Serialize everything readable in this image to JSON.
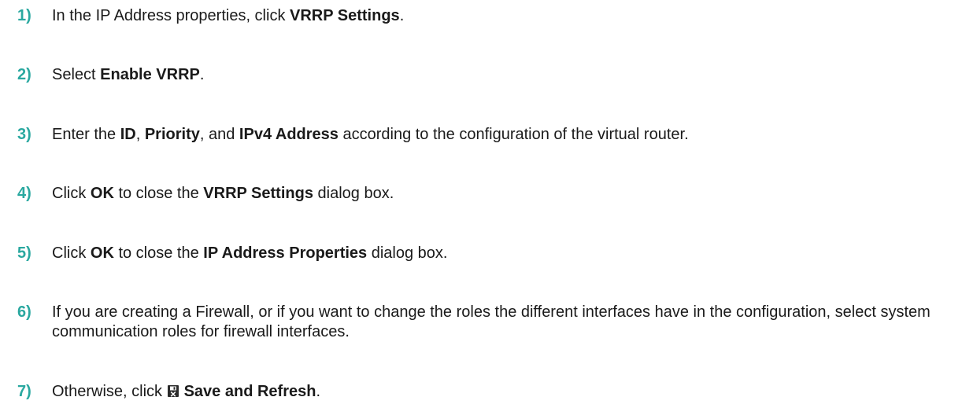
{
  "steps": [
    {
      "number": "1)",
      "parts": [
        {
          "text": "In the IP Address properties, click ",
          "bold": false
        },
        {
          "text": "VRRP Settings",
          "bold": true
        },
        {
          "text": ".",
          "bold": false
        }
      ]
    },
    {
      "number": "2)",
      "parts": [
        {
          "text": "Select ",
          "bold": false
        },
        {
          "text": "Enable VRRP",
          "bold": true
        },
        {
          "text": ".",
          "bold": false
        }
      ]
    },
    {
      "number": "3)",
      "parts": [
        {
          "text": "Enter the ",
          "bold": false
        },
        {
          "text": "ID",
          "bold": true
        },
        {
          "text": ", ",
          "bold": false
        },
        {
          "text": "Priority",
          "bold": true
        },
        {
          "text": ", and ",
          "bold": false
        },
        {
          "text": "IPv4 Address",
          "bold": true
        },
        {
          "text": " according to the configuration of the virtual router.",
          "bold": false
        }
      ]
    },
    {
      "number": "4)",
      "parts": [
        {
          "text": "Click ",
          "bold": false
        },
        {
          "text": "OK",
          "bold": true
        },
        {
          "text": " to close the ",
          "bold": false
        },
        {
          "text": "VRRP Settings",
          "bold": true
        },
        {
          "text": " dialog box.",
          "bold": false
        }
      ]
    },
    {
      "number": "5)",
      "parts": [
        {
          "text": "Click ",
          "bold": false
        },
        {
          "text": "OK",
          "bold": true
        },
        {
          "text": " to close the ",
          "bold": false
        },
        {
          "text": "IP Address Properties",
          "bold": true
        },
        {
          "text": " dialog box.",
          "bold": false
        }
      ]
    },
    {
      "number": "6)",
      "parts": [
        {
          "text": "If you are creating a Firewall, or if you want to change the roles the different interfaces have in the configuration, select system communication roles for firewall interfaces.",
          "bold": false
        }
      ]
    },
    {
      "number": "7)",
      "parts": [
        {
          "text": "Otherwise, click ",
          "bold": false
        },
        {
          "icon": "save-icon"
        },
        {
          "text": "Save and Refresh",
          "bold": true
        },
        {
          "text": ".",
          "bold": false
        }
      ]
    }
  ],
  "colors": {
    "step_number": "#2aa8a0",
    "text": "#1a1a1a"
  }
}
